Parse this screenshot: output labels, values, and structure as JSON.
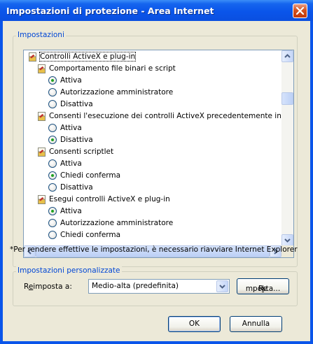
{
  "window": {
    "title": "Impostazioni di protezione - Area Internet"
  },
  "settings_group": {
    "label": "Impostazioni"
  },
  "tree": [
    {
      "type": "category",
      "indent": 0,
      "label": "Controlli ActiveX e plug-in"
    },
    {
      "type": "setting",
      "indent": 1,
      "label": "Comportamento file binari e script"
    },
    {
      "type": "option",
      "indent": 2,
      "label": "Attiva",
      "checked": true
    },
    {
      "type": "option",
      "indent": 2,
      "label": "Autorizzazione amministratore",
      "checked": false
    },
    {
      "type": "option",
      "indent": 2,
      "label": "Disattiva",
      "checked": false
    },
    {
      "type": "setting",
      "indent": 1,
      "label": "Consenti l'esecuzione dei controlli ActiveX precedentemente inutil"
    },
    {
      "type": "option",
      "indent": 2,
      "label": "Attiva",
      "checked": false
    },
    {
      "type": "option",
      "indent": 2,
      "label": "Disattiva",
      "checked": true
    },
    {
      "type": "setting",
      "indent": 1,
      "label": "Consenti scriptlet"
    },
    {
      "type": "option",
      "indent": 2,
      "label": "Attiva",
      "checked": false
    },
    {
      "type": "option",
      "indent": 2,
      "label": "Chiedi conferma",
      "checked": true
    },
    {
      "type": "option",
      "indent": 2,
      "label": "Disattiva",
      "checked": false
    },
    {
      "type": "setting",
      "indent": 1,
      "label": "Esegui controlli ActiveX e plug-in"
    },
    {
      "type": "option",
      "indent": 2,
      "label": "Attiva",
      "checked": true
    },
    {
      "type": "option",
      "indent": 2,
      "label": "Autorizzazione amministratore",
      "checked": false
    },
    {
      "type": "option",
      "indent": 2,
      "label": "Chiedi conferma",
      "checked": false
    }
  ],
  "restart_note": "*Per rendere effettive le impostazioni, è necessario riavviare Internet Explorer",
  "custom_group": {
    "label": "Impostazioni personalizzate"
  },
  "reset": {
    "label_prefix": "R",
    "label_accel": "e",
    "label_rest": "imposta a:",
    "selected": "Medio-alta (predefinita)",
    "button_prefix": "Re",
    "button_accel": "i",
    "button_rest": "mposta..."
  },
  "buttons": {
    "ok": "OK",
    "cancel": "Annulla"
  },
  "colors": {
    "title_bar": "#0a55ea",
    "face": "#ece9d8",
    "group_label": "#0046d5",
    "radio_dot": "#21a121"
  }
}
